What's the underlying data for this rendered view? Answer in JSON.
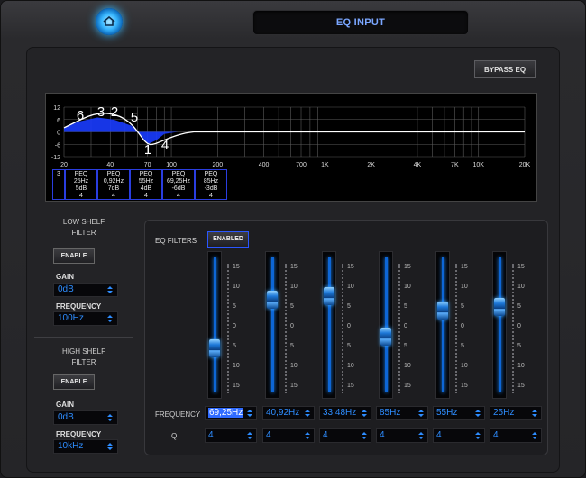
{
  "header": {
    "title": "EQ INPUT",
    "bypass_label": "BYPASS EQ",
    "logo_icon": "home-icon"
  },
  "graph": {
    "y_ticks": [
      "12",
      "6",
      "0",
      "-6",
      "-12"
    ],
    "x_ticks": [
      "20",
      "40",
      "70",
      "100",
      "200",
      "400",
      "700",
      "1K",
      "2K",
      "4K",
      "7K",
      "10K",
      "20K"
    ],
    "markers": [
      "6",
      "3",
      "2",
      "5",
      "1",
      "4"
    ],
    "peq_first": "3",
    "peq_cells": [
      {
        "name": "PEQ",
        "freq": "25Hz",
        "gain": "5dB",
        "q": "4"
      },
      {
        "name": "PEQ",
        "freq": "0,92Hz",
        "gain": "7dB",
        "q": "4"
      },
      {
        "name": "PEQ",
        "freq": "55Hz",
        "gain": "4dB",
        "q": "4"
      },
      {
        "name": "PEQ",
        "freq": "69,25Hz",
        "gain": "-6dB",
        "q": "4"
      },
      {
        "name": "PEQ",
        "freq": "85Hz",
        "gain": "-3dB",
        "q": "4"
      }
    ],
    "accent": "#1a3cff"
  },
  "low_shelf": {
    "title_line1": "LOW SHELF",
    "title_line2": "FILTER",
    "enable_label": "ENABLE",
    "gain_label": "GAIN",
    "gain_value": "0dB",
    "freq_label": "FREQUENCY",
    "freq_value": "100Hz"
  },
  "high_shelf": {
    "title_line1": "HIGH SHELF",
    "title_line2": "FILTER",
    "enable_label": "ENABLE",
    "gain_label": "GAIN",
    "gain_value": "0dB",
    "freq_label": "FREQUENCY",
    "freq_value": "10kHz"
  },
  "eq_filters": {
    "label": "EQ FILTERS",
    "enabled_label": "ENABLED",
    "scale_labels": [
      "15",
      "10",
      "5",
      "0",
      "5",
      "10",
      "15"
    ],
    "frequency_label": "FREQUENCY",
    "q_label": "Q",
    "bands": [
      {
        "frequency": "69,25Hz",
        "q": "4",
        "level": -6
      },
      {
        "frequency": "40,92Hz",
        "q": "4",
        "level": 7
      },
      {
        "frequency": "33,48Hz",
        "q": "4",
        "level": 8
      },
      {
        "frequency": "85Hz",
        "q": "4",
        "level": -3
      },
      {
        "frequency": "55Hz",
        "q": "4",
        "level": 4
      },
      {
        "frequency": "25Hz",
        "q": "4",
        "level": 5
      }
    ],
    "selected_band": 0,
    "accent": "#2e8dff"
  }
}
